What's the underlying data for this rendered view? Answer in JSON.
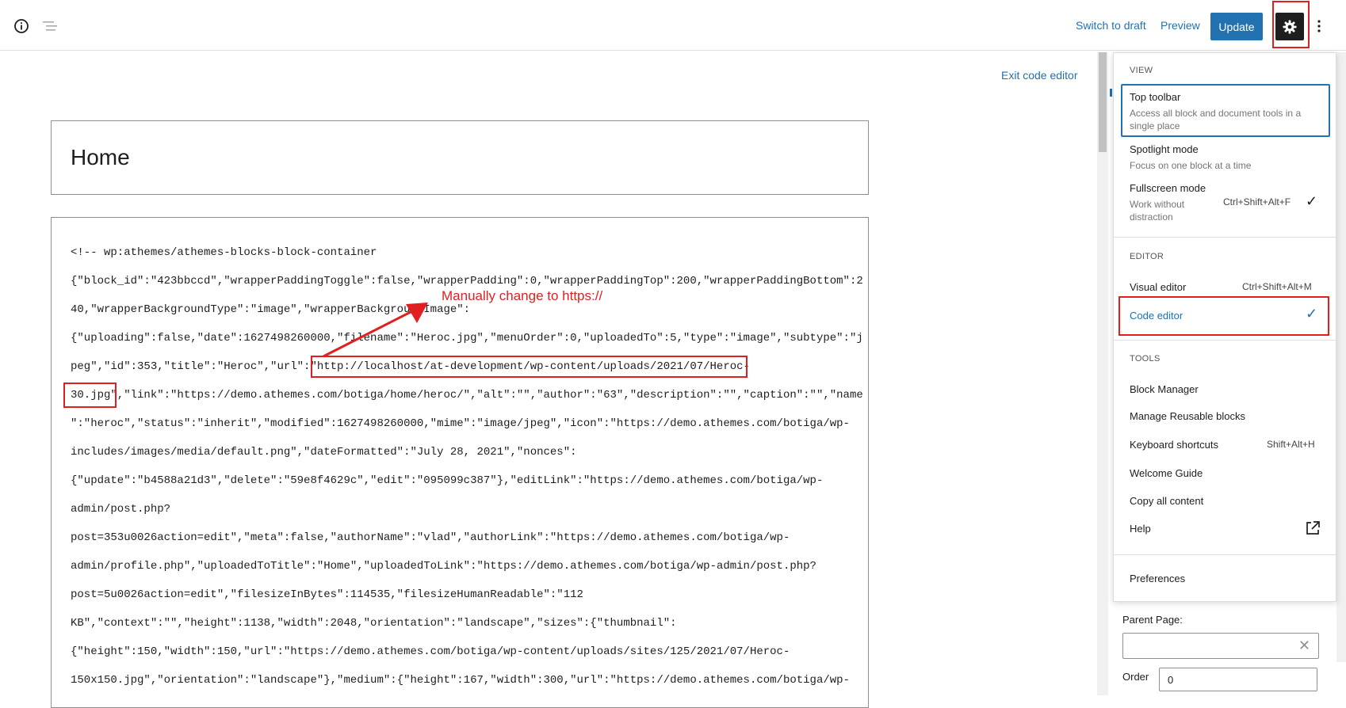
{
  "toolbar": {
    "switch_to_draft": "Switch to draft",
    "preview": "Preview",
    "update": "Update"
  },
  "editor": {
    "exit_code_editor": "Exit code editor",
    "post_title": "Home",
    "code_lines": [
      "<!-- wp:athemes/athemes-blocks-block-container",
      "{\"block_id\":\"423bbccd\",\"wrapperPaddingToggle\":false,\"wrapperPadding\":0,\"wrapperPaddingTop\":200,\"wrapperPaddingBottom\":2",
      "40,\"wrapperBackgroundType\":\"image\",\"wrapperBackgroundImage\":",
      "{\"uploading\":false,\"date\":1627498260000,\"filename\":\"Heroc.jpg\",\"menuOrder\":0,\"uploadedTo\":5,\"type\":\"image\",\"subtype\":\"j",
      "peg\",\"id\":353,\"title\":\"Heroc\",\"url\":\"http://localhost/at-development/wp-content/uploads/2021/07/Heroc-",
      "30.jpg\",\"link\":\"https://demo.athemes.com/botiga/home/heroc/\",\"alt\":\"\",\"author\":\"63\",\"description\":\"\",\"caption\":\"\",\"name",
      "\":\"heroc\",\"status\":\"inherit\",\"modified\":1627498260000,\"mime\":\"image/jpeg\",\"icon\":\"https://demo.athemes.com/botiga/wp-",
      "includes/images/media/default.png\",\"dateFormatted\":\"July 28, 2021\",\"nonces\":",
      "{\"update\":\"b4588a21d3\",\"delete\":\"59e8f4629c\",\"edit\":\"095099c387\"},\"editLink\":\"https://demo.athemes.com/botiga/wp-",
      "admin/post.php?",
      "post=353u0026action=edit\",\"meta\":false,\"authorName\":\"vlad\",\"authorLink\":\"https://demo.athemes.com/botiga/wp-",
      "admin/profile.php\",\"uploadedToTitle\":\"Home\",\"uploadedToLink\":\"https://demo.athemes.com/botiga/wp-admin/post.php?",
      "post=5u0026action=edit\",\"filesizeInBytes\":114535,\"filesizeHumanReadable\":\"112",
      "KB\",\"context\":\"\",\"height\":1138,\"width\":2048,\"orientation\":\"landscape\",\"sizes\":{\"thumbnail\":",
      "{\"height\":150,\"width\":150,\"url\":\"https://demo.athemes.com/botiga/wp-content/uploads/sites/125/2021/07/Heroc-",
      "150x150.jpg\",\"orientation\":\"landscape\"},\"medium\":{\"height\":167,\"width\":300,\"url\":\"https://demo.athemes.com/botiga/wp-"
    ]
  },
  "annotation": {
    "text": "Manually change to https://"
  },
  "menu": {
    "view_label": "VIEW",
    "top_toolbar": "Top toolbar",
    "top_toolbar_desc_1": "Access all block and document tools in a",
    "top_toolbar_desc_2": "single place",
    "spotlight": "Spotlight mode",
    "spotlight_desc": "Focus on one block at a time",
    "fullscreen": "Fullscreen mode",
    "fullscreen_desc_1": "Work without",
    "fullscreen_desc_2": "distraction",
    "fullscreen_shortcut": "Ctrl+Shift+Alt+F",
    "editor_label": "EDITOR",
    "visual_editor": "Visual editor",
    "visual_editor_shortcut": "Ctrl+Shift+Alt+M",
    "code_editor": "Code editor",
    "tools_label": "TOOLS",
    "block_manager": "Block Manager",
    "manage_reusable": "Manage Reusable blocks",
    "keyboard_shortcuts": "Keyboard shortcuts",
    "keyboard_shortcuts_shortcut": "Shift+Alt+H",
    "welcome_guide": "Welcome Guide",
    "copy_all": "Copy all content",
    "help": "Help",
    "preferences": "Preferences"
  },
  "sidebar": {
    "parent_page_label": "Parent Page:",
    "parent_page_value": "",
    "order_label": "Order",
    "order_value": "0"
  },
  "colors": {
    "accent": "#2271b1",
    "annotation": "#e02020"
  }
}
